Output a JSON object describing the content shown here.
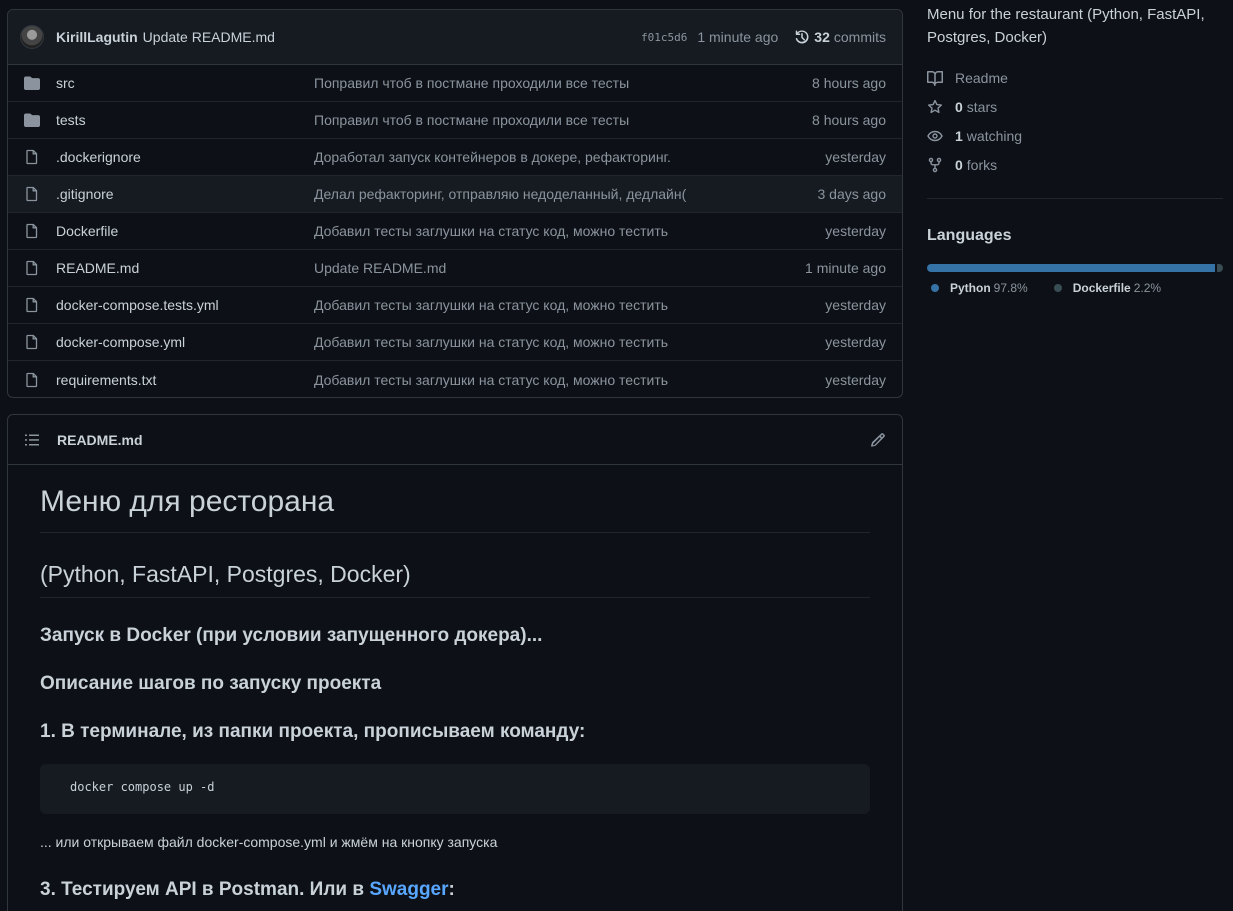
{
  "commit": {
    "author": "KirillLagutin",
    "message": "Update README.md",
    "sha": "f01c5d6",
    "time": "1 minute ago",
    "commits_count": "32",
    "commits_label": "commits"
  },
  "files": [
    {
      "type": "folder",
      "name": "src",
      "message": "Поправил чтоб в постмане проходили все тесты",
      "age": "8 hours ago"
    },
    {
      "type": "folder",
      "name": "tests",
      "message": "Поправил чтоб в постмане проходили все тесты",
      "age": "8 hours ago"
    },
    {
      "type": "file",
      "name": ".dockerignore",
      "message": "Доработал запуск контейнеров в докере, рефакторинг.",
      "age": "yesterday"
    },
    {
      "type": "file",
      "name": ".gitignore",
      "message": "Делал рефакторинг, отправляю недоделанный, дедлайн(",
      "age": "3 days ago"
    },
    {
      "type": "file",
      "name": "Dockerfile",
      "message": "Добавил тесты заглушки на статус код, можно тестить",
      "age": "yesterday"
    },
    {
      "type": "file",
      "name": "README.md",
      "message": "Update README.md",
      "age": "1 minute ago"
    },
    {
      "type": "file",
      "name": "docker-compose.tests.yml",
      "message": "Добавил тесты заглушки на статус код, можно тестить",
      "age": "yesterday"
    },
    {
      "type": "file",
      "name": "docker-compose.yml",
      "message": "Добавил тесты заглушки на статус код, можно тестить",
      "age": "yesterday"
    },
    {
      "type": "file",
      "name": "requirements.txt",
      "message": "Добавил тесты заглушки на статус код, можно тестить",
      "age": "yesterday"
    }
  ],
  "readme": {
    "header": "README.md",
    "h1": "Меню для ресторана",
    "h2": "(Python, FastAPI, Postgres, Docker)",
    "h3_launch": "Запуск в Docker (при условии запущенного докера)...",
    "h3_steps": "Описание шагов по запуску проекта",
    "h3_step1": "1. В терминале, из папки проекта, прописываем команду:",
    "code": "docker compose up -d",
    "p_alt": "... или открываем файл docker-compose.yml и жмём на кнопку запуска",
    "h3_step3_prefix": "3. Тестируем API в Postman. Или в ",
    "h3_step3_link": "Swagger",
    "h3_step3_suffix": ":"
  },
  "about": {
    "description": "Menu for the restaurant (Python, FastAPI, Postgres, Docker)",
    "readme_label": "Readme",
    "stars_count": "0",
    "stars_label": "stars",
    "watching_count": "1",
    "watching_label": "watching",
    "forks_count": "0",
    "forks_label": "forks"
  },
  "languages": {
    "title": "Languages",
    "items": [
      {
        "name": "Python",
        "percent": "97.8%",
        "value": 97.8,
        "color": "#3572A5"
      },
      {
        "name": "Dockerfile",
        "percent": "2.2%",
        "value": 2.2,
        "color": "#384d54"
      }
    ]
  },
  "colors": {
    "background": "#0d1117",
    "border": "#30363d",
    "text": "#c9d1d9",
    "muted": "#8b949e",
    "link": "#58a6ff"
  }
}
